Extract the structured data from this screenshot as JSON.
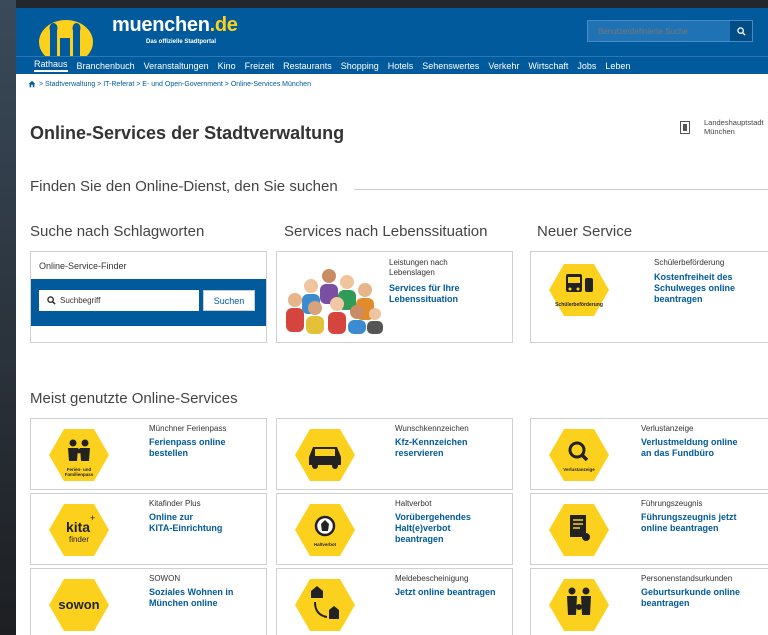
{
  "header": {
    "brand": "muenchen",
    "brand_dot": ".de",
    "tagline": "Das offizielle Stadtportal",
    "search_placeholder": "Benutzerdefinierte Suche"
  },
  "nav": [
    "Rathaus",
    "Branchenbuch",
    "Veranstaltungen",
    "Kino",
    "Freizeit",
    "Restaurants",
    "Shopping",
    "Hotels",
    "Sehenswertes",
    "Verkehr",
    "Wirtschaft",
    "Jobs",
    "Leben"
  ],
  "breadcrumb": "> Stadtverwaltung > IT-Referat > E- und Open-Government > Online-Services München",
  "page_title": "Online-Services der Stadtverwaltung",
  "city_label_1": "Landeshauptstadt",
  "city_label_2": "München",
  "finden": "Finden Sie den Online-Dienst, den Sie suchen",
  "col_headings": [
    "Suche nach Schlagworten",
    "Services nach Lebenssituation",
    "Neuer Service"
  ],
  "finder": {
    "title": "Online-Service-Finder",
    "placeholder": "Suchbegriff",
    "button": "Suchen"
  },
  "leben": {
    "cat": [
      "Leistungen nach",
      "Lebenslagen"
    ],
    "link": [
      "Services für Ihre",
      "Lebenssituation"
    ]
  },
  "neu": {
    "cat": "Schülerbeförderung",
    "link": [
      "Kostenfreiheit des",
      "Schulweges online",
      "beantragen"
    ],
    "icon_label": "Schülerbeförderung"
  },
  "meist": "Meist genutzte Online-Services",
  "services": [
    {
      "cat": "Münchner Ferienpass",
      "link": [
        "Ferienpass online",
        "bestellen"
      ],
      "icon_label": [
        "Ferien- und",
        "Familienpass"
      ]
    },
    {
      "cat": "Wunschkennzeichen",
      "link": [
        "Kfz-Kennzeichen",
        "reservieren"
      ],
      "icon_label": []
    },
    {
      "cat": "Verlustanzeige",
      "link": [
        "Verlustmeldung online",
        "an das Fundbüro"
      ],
      "icon_label": [
        "Verlustanzeige"
      ]
    },
    {
      "cat": "Kitafinder Plus",
      "link": [
        "Online zur",
        "KITA-Einrichtung"
      ],
      "icon_label": [
        "kita",
        "finder"
      ]
    },
    {
      "cat": "Haltverbot",
      "link": [
        "Vorübergehendes",
        "Halt(e)verbot",
        "beantragen"
      ],
      "icon_label": [
        "Haltverbot"
      ]
    },
    {
      "cat": "Führungszeugnis",
      "link": [
        "Führungszeugnis jetzt",
        "online beantragen"
      ],
      "icon_label": []
    },
    {
      "cat": "SOWON",
      "link": [
        "Soziales Wohnen in",
        "München online"
      ],
      "icon_label": [
        "sowon"
      ]
    },
    {
      "cat": "Meldebescheinigung",
      "link": [
        "Jetzt online beantragen"
      ],
      "icon_label": []
    },
    {
      "cat": "Personenstandsurkunden",
      "link": [
        "Geburtsurkunde online",
        "beantragen"
      ],
      "icon_label": []
    }
  ],
  "colors": {
    "brand_blue": "#005a9b",
    "hex_yellow": "#fcd11d"
  }
}
